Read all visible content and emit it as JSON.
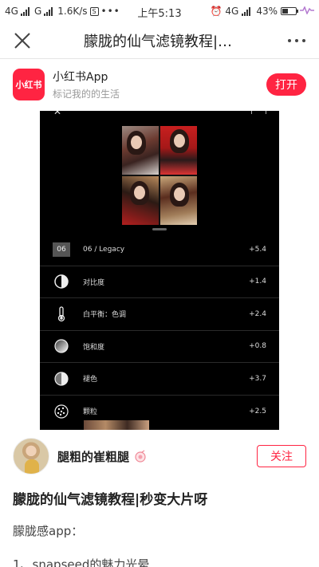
{
  "status_bar": {
    "network_1": "4G",
    "network_2": "G",
    "speed": "1.6K/s",
    "time": "上午5:13",
    "network_3": "4G",
    "battery": "43%",
    "battery_level": 0.43
  },
  "header": {
    "title": "朦胧的仙气滤镜教程|…"
  },
  "app_banner": {
    "logo_text": "小红书",
    "app_name": "小红书App",
    "slogan": "标记我的的生活",
    "open_label": "打开",
    "brand_color": "#ff2442"
  },
  "editor": {
    "adjustments": [
      {
        "icon": "preset-badge",
        "badge": "06",
        "label": "06 / Legacy",
        "value": "+5.4"
      },
      {
        "icon": "contrast-icon",
        "label": "对比度",
        "value": "+1.4"
      },
      {
        "icon": "thermometer-icon",
        "label": "白平衡：色调",
        "value": "+2.4"
      },
      {
        "icon": "saturation-icon",
        "label": "饱和度",
        "value": "+0.8"
      },
      {
        "icon": "fade-icon",
        "label": "褪色",
        "value": "+3.7"
      },
      {
        "icon": "grain-icon",
        "label": "颗粒",
        "value": "+2.5"
      }
    ]
  },
  "author": {
    "name": "腿粗的崔粗腿",
    "follow_label": "关注"
  },
  "post": {
    "title": "朦胧的仙气滤镜教程|秒变大片呀",
    "line1": "朦胧感app：",
    "line2": "1、snapseed的魅力光晕"
  }
}
